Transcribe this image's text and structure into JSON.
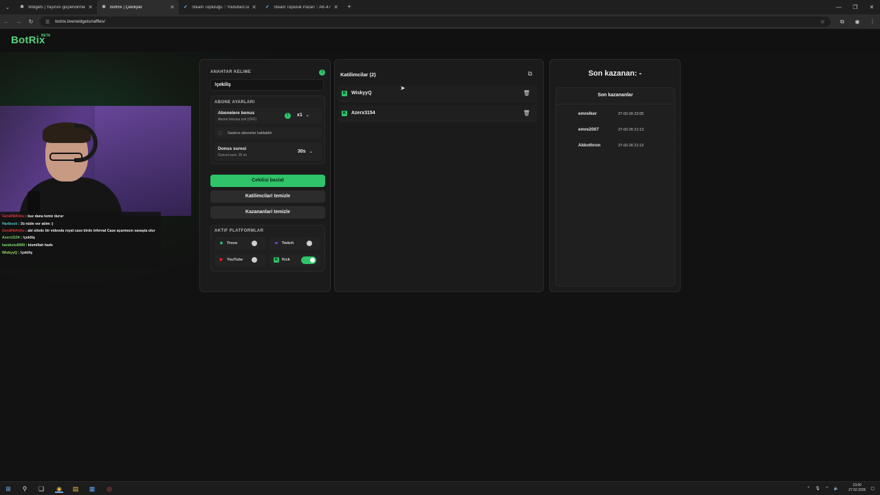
{
  "browser": {
    "tabs": [
      {
        "label": "Widgets | Yayınını güçlendirmek",
        "icon": "gear-icon",
        "active": false
      },
      {
        "label": "BotRix | Çekilişler",
        "icon": "gear-icon",
        "active": true
      },
      {
        "label": "Steam Topluluğu :: Youtube/Csm",
        "icon": "steam-icon",
        "active": false
      },
      {
        "label": "Steam Topluluk Pazarı :: AK-47 |",
        "icon": "steam-icon",
        "active": false
      }
    ],
    "url": "botrix.live/widgets/raffles/"
  },
  "site": {
    "logo": "BotRix",
    "beta": "BETA"
  },
  "chat": [
    {
      "user": "GeraRikKidsi",
      "sep": " : ",
      "msg": "buz dana temiz durur"
    },
    {
      "user": "Haribosk",
      "sep": " : ",
      "msg": "3ü nüde ver abim :)"
    },
    {
      "user": "GeraRikKidsi",
      "sep": " : ",
      "msg": "abi sitede bir videoda royal case birde infernal Case açarmısın savaşta olur"
    },
    {
      "user": "Azerx3154",
      "sep": " : ",
      "msg": "!çekiliş"
    },
    {
      "user": "karakutu8989",
      "sep": " : ",
      "msg": "bismillah hade"
    },
    {
      "user": "WiskyyQ",
      "sep": " : ",
      "msg": "!çekiliş"
    }
  ],
  "settings": {
    "keyword_title": "ANAHTAR KELIME",
    "keyword_value": "!çekiliş",
    "sub_title": "ABONE AYARLARI",
    "bonus_label": "Abonelere bonus",
    "bonus_sub": "Abone bonusu yok (OFF)",
    "bonus_value": "x1",
    "subs_only_label": "Sadece aboneler katilabilir",
    "duration_label": "Donus suresi",
    "duration_sub": "Guncel sure: 30 sn",
    "duration_value": "30s",
    "start_button": "Cekilisi baslat",
    "clear_participants": "Katilimcilari temizle",
    "clear_winners": "Kazananlari temizle",
    "platforms_title": "AKTIF PLATFORMLAR",
    "platforms": [
      {
        "name": "Trovo",
        "enabled": false,
        "color": "#1fc275"
      },
      {
        "name": "Twitch",
        "enabled": false,
        "color": "#9147ff"
      },
      {
        "name": "YouTube",
        "enabled": false,
        "color": "#ff2020"
      },
      {
        "name": "Kick",
        "enabled": true,
        "color": "#2fc36a"
      }
    ]
  },
  "participants": {
    "title": "Katilimcilar (2)",
    "list": [
      {
        "name": "WiskyyQ",
        "platform": "kick"
      },
      {
        "name": "Azerx3154",
        "platform": "kick"
      }
    ]
  },
  "winners": {
    "last_winner": "Son kazanan: -",
    "list_title": "Son kazananlar",
    "list": [
      {
        "name": "emrelker",
        "date": "27-02-26 22:05"
      },
      {
        "name": "emre2007",
        "date": "27-02-26 21:13"
      },
      {
        "name": "Akkothron",
        "date": "27-02-26 21:12"
      }
    ]
  },
  "taskbar": {
    "time": "23:00",
    "date": "27.02.2026"
  },
  "colors": {
    "accent": "#2fc36a",
    "logo": "#53d37a"
  }
}
